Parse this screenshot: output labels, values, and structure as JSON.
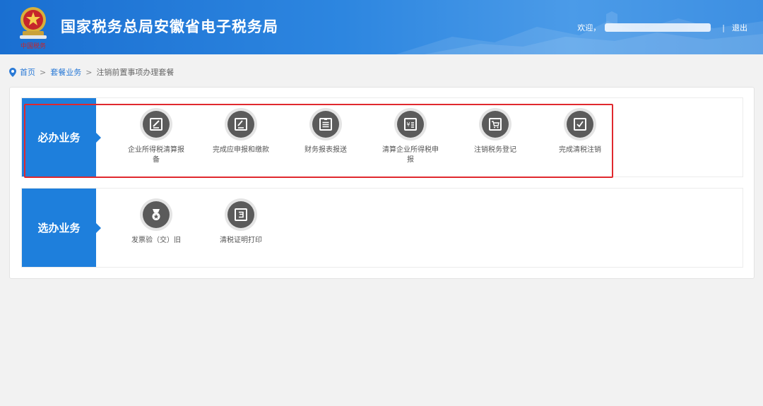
{
  "header": {
    "title": "国家税务总局安徽省电子税务局",
    "welcome": "欢迎，",
    "separator": "|",
    "logout": "退出",
    "emblem_caption": "中国税务"
  },
  "breadcrumb": {
    "home": "首页",
    "level1": "套餐业务",
    "current": "注销前置事项办理套餐",
    "gt": ">"
  },
  "required": {
    "label": "必办业务",
    "items": [
      {
        "label": "企业所得税清算报备",
        "icon": "edit-document-icon"
      },
      {
        "label": "完成应申报和缴款",
        "icon": "declare-document-icon"
      },
      {
        "label": "财务报表报送",
        "icon": "report-list-icon"
      },
      {
        "label": "清算企业所得税申报",
        "icon": "yuan-document-icon"
      },
      {
        "label": "注销税务登记",
        "icon": "cart-icon"
      },
      {
        "label": "完成清税注销",
        "icon": "checkbox-icon"
      }
    ]
  },
  "optional": {
    "label": "选办业务",
    "items": [
      {
        "label": "发票验（交）旧",
        "icon": "medal-icon"
      },
      {
        "label": "清税证明打印",
        "icon": "certificate-icon"
      }
    ]
  },
  "colors": {
    "header_blue": "#1a6fd1",
    "section_blue": "#1e7fdc",
    "icon_gray": "#5b5b5b",
    "highlight_red": "#e0282e",
    "link_blue": "#2a7ad6"
  }
}
